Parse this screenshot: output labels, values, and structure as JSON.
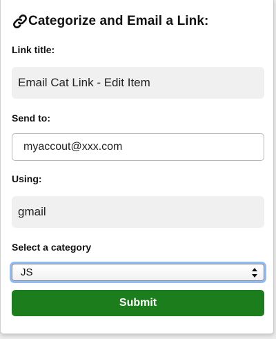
{
  "header": {
    "icon": "link-icon",
    "title": "Categorize and Email a Link:"
  },
  "form": {
    "link_title_label": "Link title:",
    "link_title_value": "Email Cat Link - Edit Item",
    "send_to_label": "Send to:",
    "send_to_value": "myaccout@xxx.com",
    "using_label": "Using:",
    "using_value": "gmail",
    "category_label": "Select a category",
    "category_selected": "JS",
    "submit_label": "Submit"
  },
  "colors": {
    "submit_bg": "#1c7d1c",
    "focus_ring": "#8fbaf2",
    "readonly_bg": "#f0f0f0"
  }
}
